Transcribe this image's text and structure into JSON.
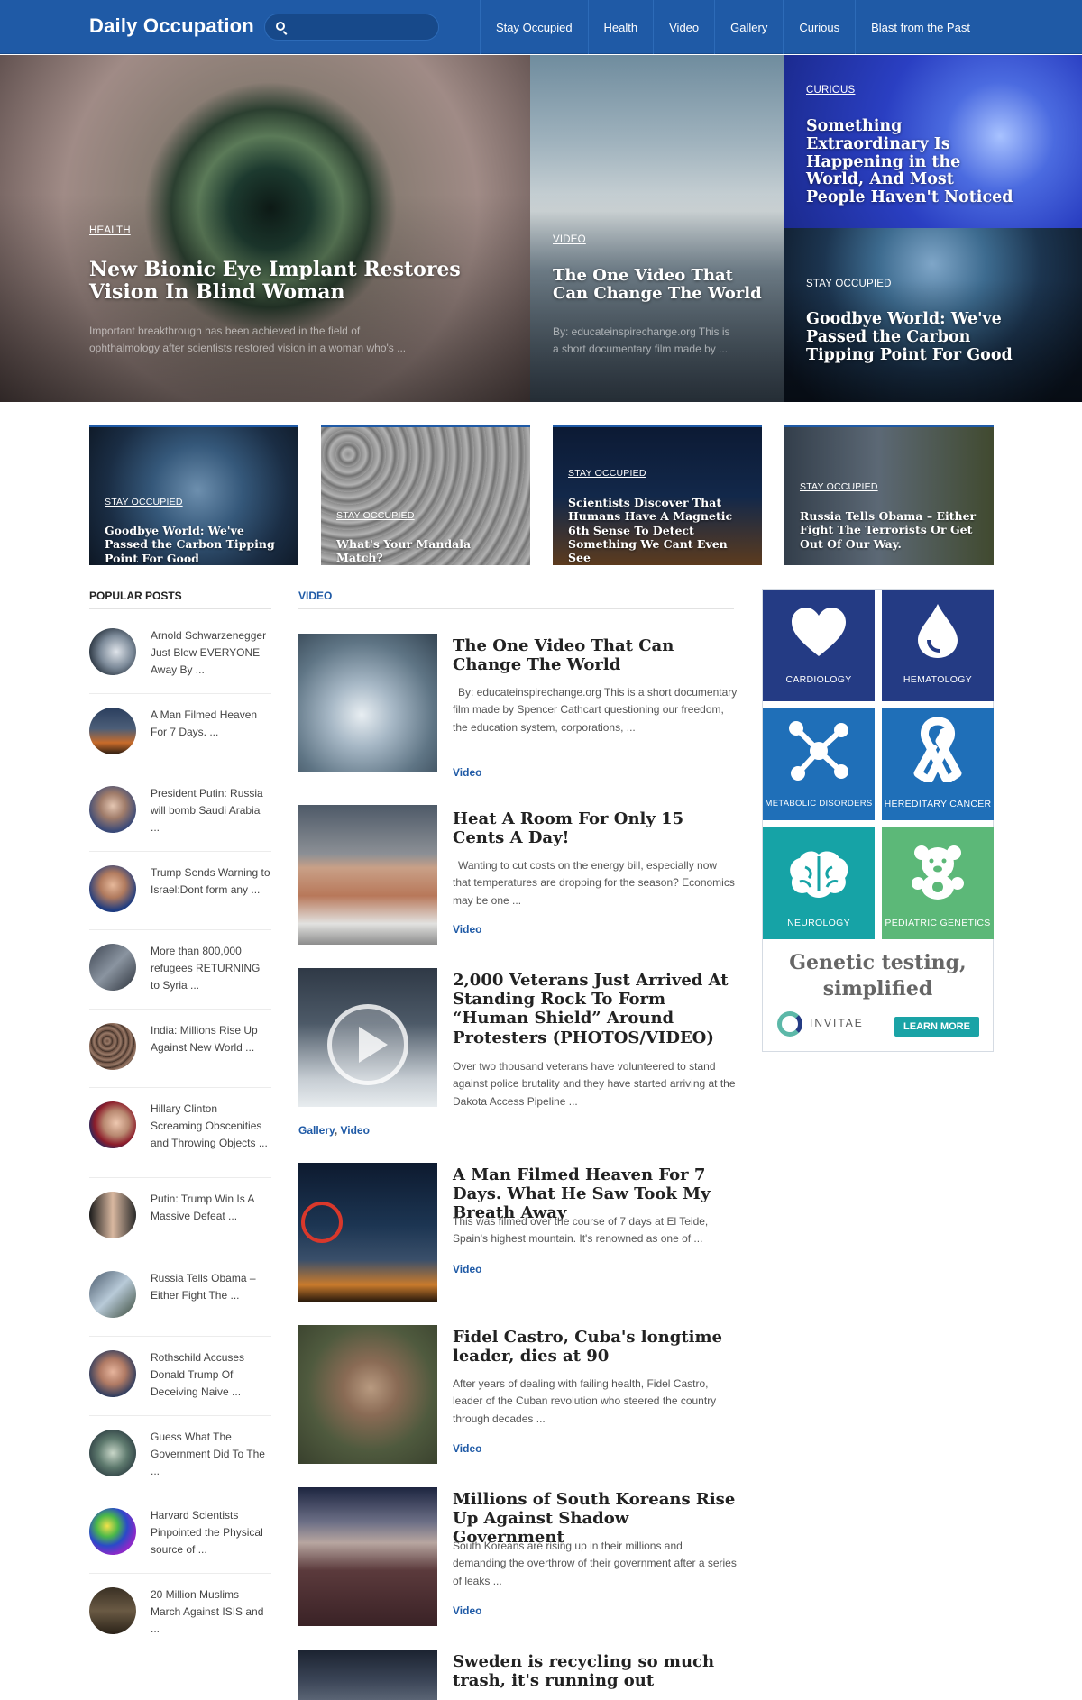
{
  "header": {
    "logo": "Daily Occupation",
    "search_placeholder": "",
    "nav": [
      "Stay Occupied",
      "Health",
      "Video",
      "Gallery",
      "Curious",
      "Blast from the Past"
    ]
  },
  "hero": {
    "main": {
      "tag": "HEALTH",
      "title": "New Bionic Eye Implant Restores Vision In Blind Woman",
      "excerpt": "Important breakthrough has been achieved in the field of ophthalmology after scientists restored vision in a woman who's ..."
    },
    "middle": {
      "tag": "VIDEO",
      "title": "The One Video That Can Change The World",
      "excerpt": "By: educateinspirechange.org This is a short documentary film made by ..."
    },
    "top_right": {
      "tag": "CURIOUS",
      "title": "Something Extraordinary Is Happening in the World, And Most People Haven't Noticed"
    },
    "bottom_right": {
      "tag": "STAY OCCUPIED",
      "title": "Goodbye World: We've Passed the Carbon Tipping Point For Good"
    }
  },
  "featured": [
    {
      "tag": "STAY OCCUPIED",
      "title": "Goodbye World: We've Passed the Carbon Tipping Point For Good"
    },
    {
      "tag": "STAY OCCUPIED",
      "title": "What's Your Mandala Match?"
    },
    {
      "tag": "STAY OCCUPIED",
      "title": "Scientists Discover That Humans Have A Magnetic 6th Sense To Detect Something We Cant Even See"
    },
    {
      "tag": "STAY OCCUPIED",
      "title": "Russia Tells Obama – Either Fight The Terrorists Or Get Out Of Our Way."
    }
  ],
  "popular": {
    "heading": "POPULAR POSTS",
    "items": [
      "Arnold Schwarzenegger Just Blew EVERYONE Away By ...",
      "A Man Filmed Heaven For 7 Days. ...",
      "President Putin: Russia will bomb Saudi Arabia ...",
      "Trump Sends Warning to Israel:Dont form any ...",
      "More than 800,000 refugees RETURNING to Syria ...",
      "India: Millions Rise Up Against New World ...",
      "Hillary Clinton Screaming Obscenities and Throwing Objects ...",
      "Putin: Trump Win Is A Massive Defeat ...",
      "Russia Tells Obama – Either Fight The ...",
      "Rothschild Accuses Donald Trump Of Deceiving Naive ...",
      "Guess What The Government Did To The ...",
      "Harvard Scientists Pinpointed the Physical source of ...",
      "20 Million Muslims March Against ISIS and ..."
    ]
  },
  "video": {
    "heading": "VIDEO",
    "posts": [
      {
        "title": "The One Video That Can Change The World",
        "excerpt": "By: educateinspirechange.org This is a short documentary film made by Spencer Cathcart questioning our freedom, the education system, corporations, ...",
        "cat": "Video"
      },
      {
        "title": "Heat A Room For Only 15 Cents A Day!",
        "excerpt": "Wanting to cut costs on the energy bill, especially now that temperatures are dropping for the season? Economics may be one ...",
        "cat": "Video"
      },
      {
        "title": "2,000 Veterans Just Arrived At Standing Rock To Form “Human Shield” Around Protesters (PHOTOS/VIDEO)",
        "excerpt": "Over two thousand veterans have volunteered to stand against police brutality and they have started arriving at the Dakota Access Pipeline ...",
        "cat_a": "Gallery",
        "cat_sep": ", ",
        "cat_b": "Video"
      },
      {
        "title": "A Man Filmed Heaven For 7 Days. What He Saw Took My Breath Away",
        "excerpt": "This was filmed over the course of 7 days at El Teide, Spain's highest mountain. It's renowned as one of ...",
        "cat": "Video"
      },
      {
        "title": "Fidel Castro, Cuba's longtime leader, dies at 90",
        "excerpt": "After years of dealing with failing health, Fidel Castro, leader of the Cuban revolution who steered the country through decades ...",
        "cat": "Video"
      },
      {
        "title": "Millions of South Koreans Rise Up Against Shadow Government",
        "excerpt": "South Koreans are rising up in their millions and demanding the overthrow of their government after a series of leaks ...",
        "cat": "Video"
      },
      {
        "title": "Sweden is recycling so much trash, it's running out",
        "excerpt": "",
        "cat": ""
      }
    ]
  },
  "ad": {
    "tiles": [
      "CARDIOLOGY",
      "HEMATOLOGY",
      "METABOLIC DISORDERS",
      "HEREDITARY CANCER",
      "NEUROLOGY",
      "PEDIATRIC GENETICS"
    ],
    "slogan_1": "Genetic testing,",
    "slogan_2": "simplified",
    "brand": "INVITAE",
    "cta": "LEARN MORE",
    "close": "▷ ✕"
  },
  "colors": {
    "brand": "#1f5aa6",
    "tile_navy": "#243b84",
    "tile_blue": "#1f6fb8",
    "tile_teal": "#16a3a6",
    "tile_green": "#5cb878"
  }
}
